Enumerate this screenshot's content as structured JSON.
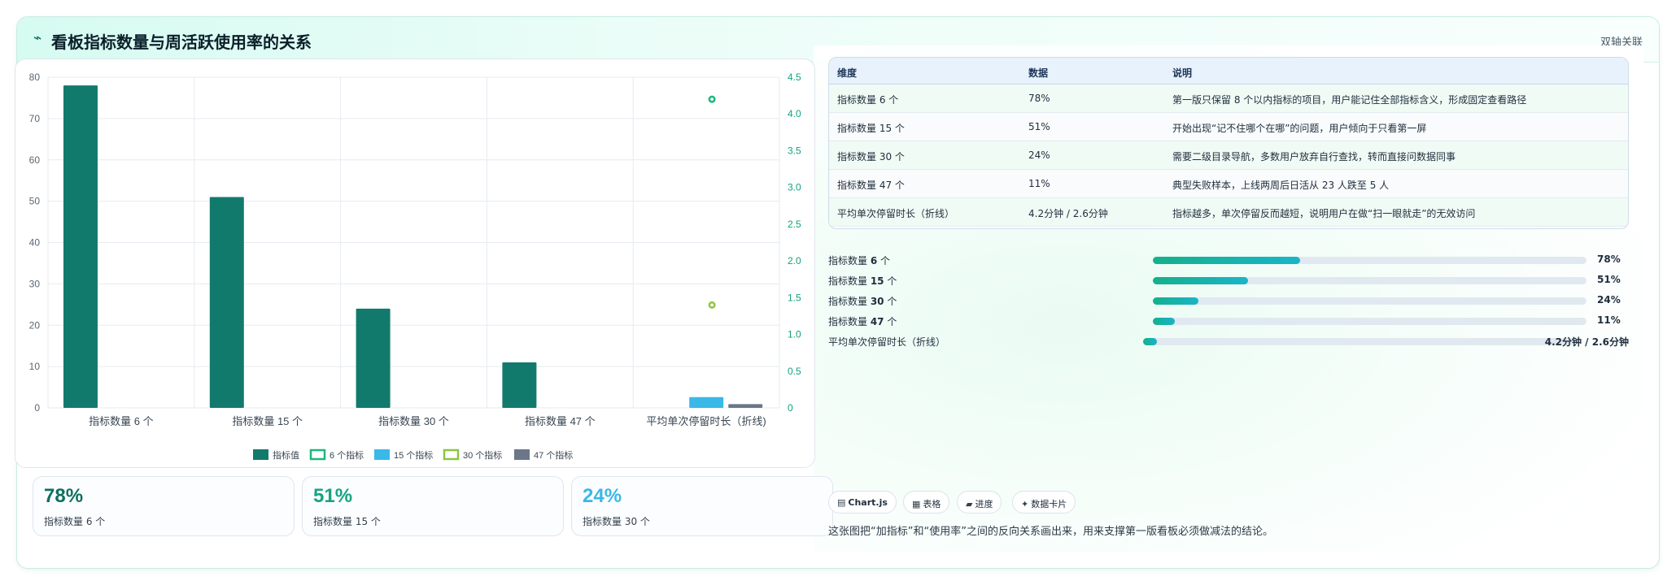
{
  "header": {
    "icon": "trend-icon",
    "icon_glyph": "⌁",
    "title": "看板指标数量与周活跃使用率的关系",
    "right_label": "双轴关联"
  },
  "chart_data": {
    "type": "bar",
    "categories": [
      "指标数量 6 个",
      "指标数量 15 个",
      "指标数量 30 个",
      "指标数量 47 个",
      "平均单次停留时长（折线)"
    ],
    "series": [
      {
        "name": "指标值",
        "type": "bar",
        "axis": "left",
        "color": "#127a6d",
        "values": [
          78,
          51,
          24,
          11,
          null
        ]
      },
      {
        "name": "6 个指标",
        "type": "point",
        "axis": "right",
        "color": "#1cb87d",
        "values": [
          null,
          null,
          null,
          null,
          4.2
        ]
      },
      {
        "name": "15 个指标",
        "type": "bar",
        "axis": "left",
        "color": "#3ab8e8",
        "values": [
          null,
          null,
          null,
          null,
          2.6
        ]
      },
      {
        "name": "30 个指标",
        "type": "point",
        "axis": "right",
        "color": "#8cc63f",
        "values": [
          null,
          null,
          null,
          null,
          1.4
        ]
      },
      {
        "name": "47 个指标",
        "type": "bar",
        "axis": "left",
        "color": "#6b7689",
        "values": [
          null,
          null,
          null,
          null,
          0.9
        ]
      }
    ],
    "y_left": {
      "min": 0,
      "max": 80,
      "ticks": [
        "0",
        "10",
        "20",
        "30",
        "40",
        "50",
        "60",
        "70",
        "80"
      ]
    },
    "y_right": {
      "min": 0,
      "max": 4.5,
      "ticks": [
        "0",
        "0.5",
        "1.0",
        "1.5",
        "2.0",
        "2.5",
        "3.0",
        "3.5",
        "4.0",
        "4.5"
      ],
      "color": "#13a17c"
    },
    "grid": true,
    "legend_position": "bottom"
  },
  "stats": [
    {
      "value": "78%",
      "label": "指标数量 6 个",
      "color": "#0f6f5f"
    },
    {
      "value": "51%",
      "label": "指标数量 15 个",
      "color": "#16a383"
    },
    {
      "value": "24%",
      "label": "指标数量 30 个",
      "color": "#3ab8e8"
    }
  ],
  "table": {
    "headers": [
      "维度",
      "数据",
      "说明"
    ],
    "rows": [
      [
        "指标数量 6 个",
        "78%",
        "第一版只保留 8 个以内指标的项目，用户能记住全部指标含义，形成固定查看路径"
      ],
      [
        "指标数量 15 个",
        "51%",
        "开始出现“记不住哪个在哪”的问题，用户倾向于只看第一屏"
      ],
      [
        "指标数量 30 个",
        "24%",
        "需要二级目录导航，多数用户放弃自行查找，转而直接问数据同事"
      ],
      [
        "指标数量 47 个",
        "11%",
        "典型失败样本，上线两周后日活从 23 人跌至 5 人"
      ],
      [
        "平均单次停留时长（折线）",
        "4.2分钟 / 2.6分钟",
        "指标越多，单次停留反而越短，说明用户在做“扫一眼就走”的无效访问"
      ]
    ]
  },
  "progress": [
    {
      "label_prefix": "指标数量 ",
      "label_bold": "6",
      "label_suffix": " 个",
      "value": "78%",
      "fraction": 0.34
    },
    {
      "label_prefix": "指标数量 ",
      "label_bold": "15",
      "label_suffix": " 个",
      "value": "51%",
      "fraction": 0.22
    },
    {
      "label_prefix": "指标数量 ",
      "label_bold": "30",
      "label_suffix": " 个",
      "value": "24%",
      "fraction": 0.105
    },
    {
      "label_prefix": "指标数量 ",
      "label_bold": "47",
      "label_suffix": " 个",
      "value": "11%",
      "fraction": 0.05
    },
    {
      "label_prefix": "平均单次停留时长（折线）",
      "label_bold": "",
      "label_suffix": "",
      "value": "4.2分钟 / 2.6分钟",
      "fraction": 0.033
    }
  ],
  "chips": [
    {
      "icon": "chart-icon",
      "glyph": "▤",
      "label": "Chart.js"
    },
    {
      "icon": "table-icon",
      "glyph": "▦",
      "label": "表格"
    },
    {
      "icon": "progress-icon",
      "glyph": "▰",
      "label": "进度"
    },
    {
      "icon": "card-icon",
      "glyph": "✦",
      "label": "数据卡片"
    }
  ],
  "note": "这张图把“加指标”和“使用率”之间的反向关系画出来，用来支撑第一版看板必须做减法的结论。"
}
